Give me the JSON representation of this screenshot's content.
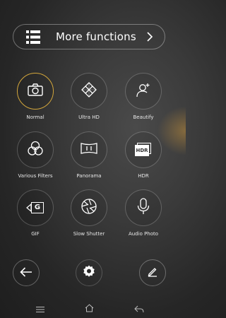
{
  "header": {
    "more_functions_label": "More functions"
  },
  "modes": [
    {
      "label": "Normal",
      "icon": "camera-icon",
      "active": true
    },
    {
      "label": "Ultra HD",
      "icon": "ultra-hd-icon",
      "active": false
    },
    {
      "label": "Beautify",
      "icon": "beautify-icon",
      "active": false
    },
    {
      "label": "Various Filters",
      "icon": "filters-icon",
      "active": false
    },
    {
      "label": "Panorama",
      "icon": "panorama-icon",
      "active": false
    },
    {
      "label": "HDR",
      "icon": "hdr-icon",
      "active": false
    },
    {
      "label": "GIF",
      "icon": "gif-icon",
      "active": false
    },
    {
      "label": "Slow Shutter",
      "icon": "slow-shutter-icon",
      "active": false
    },
    {
      "label": "Audio Photo",
      "icon": "microphone-icon",
      "active": false
    }
  ],
  "icon_text": {
    "hdr": "HDR",
    "gif": "G"
  },
  "colors": {
    "accent": "#d4a73c"
  }
}
